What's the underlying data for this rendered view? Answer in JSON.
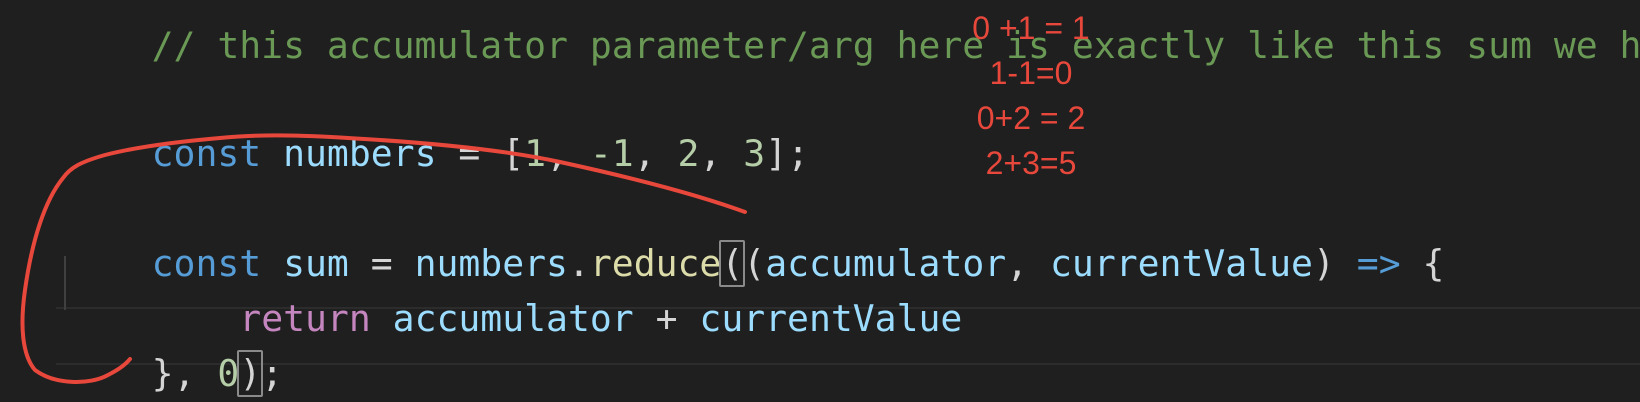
{
  "code": {
    "comment_line": "// this accumulator parameter/arg here is exactly like this sum we h",
    "line_numbers_decl": {
      "kw": "const",
      "name": "numbers",
      "eq": " = ",
      "open": "[",
      "n1": "1",
      "sep1": ", ",
      "n2": "-1",
      "sep2": ", ",
      "n3": "2",
      "sep3": ", ",
      "n4": "3",
      "close": "];"
    },
    "line_sum_decl": {
      "kw": "const",
      "name": "sum",
      "eq": " = ",
      "obj": "numbers",
      "dot": ".",
      "method": "reduce",
      "paren_open": "(",
      "params_open": "(",
      "param1": "accumulator",
      "comma": ", ",
      "param2": "currentValue",
      "params_close": ")",
      "arrow": "=>",
      "brace": "{"
    },
    "line_return": {
      "kw": "return",
      "left": "accumulator",
      "op": " + ",
      "right": "currentValue"
    },
    "line_close": {
      "brace": "},",
      "init": "0",
      "paren_close": ")",
      "semi": ";"
    }
  },
  "annotations": {
    "notes": [
      "0 +1 = 1",
      "1-1=0",
      "0+2 = 2",
      "2+3=5"
    ],
    "ink_color": "#e8483b"
  },
  "theme": {
    "background": "#1f1f1f",
    "keyword": "#569cd6",
    "control": "#c586c0",
    "variable": "#9cdcfe",
    "function": "#dcdcaa",
    "number": "#b5cea8",
    "comment": "#6a9955"
  }
}
